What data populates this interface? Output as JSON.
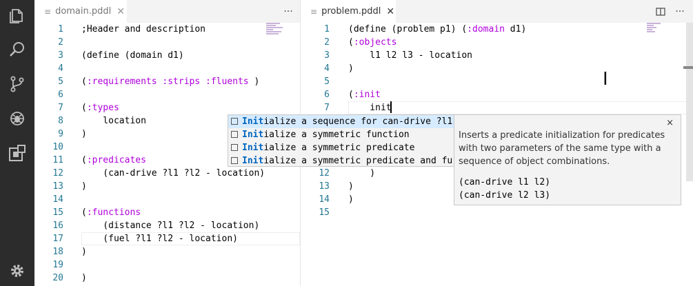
{
  "left_editor": {
    "tab": {
      "filename": "domain.pddl",
      "close": "✕",
      "more": "···"
    },
    "lines": [
      {
        "n": "1",
        "segments": [
          {
            "t": ";Header and description",
            "k": "plain"
          }
        ]
      },
      {
        "n": "2",
        "segments": []
      },
      {
        "n": "3",
        "segments": [
          {
            "t": "(define (domain d1)",
            "k": "plain"
          }
        ]
      },
      {
        "n": "4",
        "segments": []
      },
      {
        "n": "5",
        "segments": [
          {
            "t": "(",
            "k": "plain"
          },
          {
            "t": ":requirements :strips :fluents",
            "k": "kw"
          },
          {
            "t": " )",
            "k": "plain"
          }
        ]
      },
      {
        "n": "6",
        "segments": []
      },
      {
        "n": "7",
        "segments": [
          {
            "t": "(",
            "k": "plain"
          },
          {
            "t": ":types",
            "k": "kw"
          }
        ]
      },
      {
        "n": "8",
        "segments": [
          {
            "t": "    location",
            "k": "plain"
          }
        ]
      },
      {
        "n": "9",
        "segments": [
          {
            "t": ")",
            "k": "plain"
          }
        ]
      },
      {
        "n": "10",
        "segments": []
      },
      {
        "n": "11",
        "segments": [
          {
            "t": "(",
            "k": "plain"
          },
          {
            "t": ":predicates",
            "k": "kw"
          }
        ]
      },
      {
        "n": "12",
        "segments": [
          {
            "t": "    (can-drive ?l1 ?l2 - location)",
            "k": "plain"
          }
        ]
      },
      {
        "n": "13",
        "segments": [
          {
            "t": ")",
            "k": "plain"
          }
        ]
      },
      {
        "n": "14",
        "segments": []
      },
      {
        "n": "15",
        "segments": [
          {
            "t": "(",
            "k": "plain"
          },
          {
            "t": ":functions",
            "k": "kw"
          }
        ]
      },
      {
        "n": "16",
        "segments": [
          {
            "t": "    (distance ?l1 ?l2 - location)",
            "k": "plain"
          }
        ]
      },
      {
        "n": "17",
        "segments": [
          {
            "t": "    (fuel ?l1 ?l2 - location)",
            "k": "plain"
          }
        ]
      },
      {
        "n": "18",
        "segments": [
          {
            "t": ")",
            "k": "plain"
          }
        ]
      },
      {
        "n": "19",
        "segments": []
      },
      {
        "n": "20",
        "segments": [
          {
            "t": ")",
            "k": "plain"
          }
        ]
      }
    ]
  },
  "right_editor": {
    "tab": {
      "filename": "problem.pddl",
      "close": "✕",
      "split": "split-editor-icon",
      "more": "···"
    },
    "lines": [
      {
        "n": "1",
        "segments": [
          {
            "t": "(define (problem p1) (",
            "k": "plain"
          },
          {
            "t": ":domain",
            "k": "kw"
          },
          {
            "t": " d1)",
            "k": "plain"
          }
        ]
      },
      {
        "n": "2",
        "segments": [
          {
            "t": "(",
            "k": "plain"
          },
          {
            "t": ":objects",
            "k": "kw"
          }
        ]
      },
      {
        "n": "3",
        "segments": [
          {
            "t": "    l1 l2 l3 - location",
            "k": "plain"
          }
        ]
      },
      {
        "n": "4",
        "segments": [
          {
            "t": ")",
            "k": "plain"
          }
        ]
      },
      {
        "n": "5",
        "segments": []
      },
      {
        "n": "6",
        "segments": [
          {
            "t": "(",
            "k": "plain"
          },
          {
            "t": ":init",
            "k": "kw"
          }
        ]
      },
      {
        "n": "7",
        "segments": [
          {
            "t": "    init",
            "k": "plain"
          }
        ]
      },
      {
        "n": "12",
        "segments": [
          {
            "t": "    )",
            "k": "plain"
          }
        ]
      },
      {
        "n": "13",
        "segments": [
          {
            "t": ")",
            "k": "plain"
          }
        ]
      },
      {
        "n": "14",
        "segments": [
          {
            "t": ")",
            "k": "plain"
          }
        ]
      },
      {
        "n": "15",
        "segments": []
      }
    ]
  },
  "suggest": {
    "match": "Init",
    "items": [
      {
        "rest": "ialize a sequence for can-drive ?l1",
        "selected": true
      },
      {
        "rest": "ialize a symmetric function",
        "selected": false
      },
      {
        "rest": "ialize a symmetric predicate",
        "selected": false
      },
      {
        "rest": "ialize a symmetric predicate and fu",
        "selected": false
      }
    ]
  },
  "details": {
    "close": "×",
    "description": "Inserts a predicate initialization for predicates with two parameters of the same type with a sequence of object combinations.",
    "example": [
      "(can-drive l1 l2)",
      "(can-drive l2 l3)"
    ]
  },
  "activity_bar": [
    "files-icon",
    "search-icon",
    "source-control-icon",
    "debug-icon",
    "extensions-icon",
    "settings-gear-icon"
  ],
  "colors": {
    "keyword": "#af00db",
    "line_number": "#237893",
    "activity_bar": "#2c2c2c",
    "suggest_highlight": "#0066bf"
  }
}
